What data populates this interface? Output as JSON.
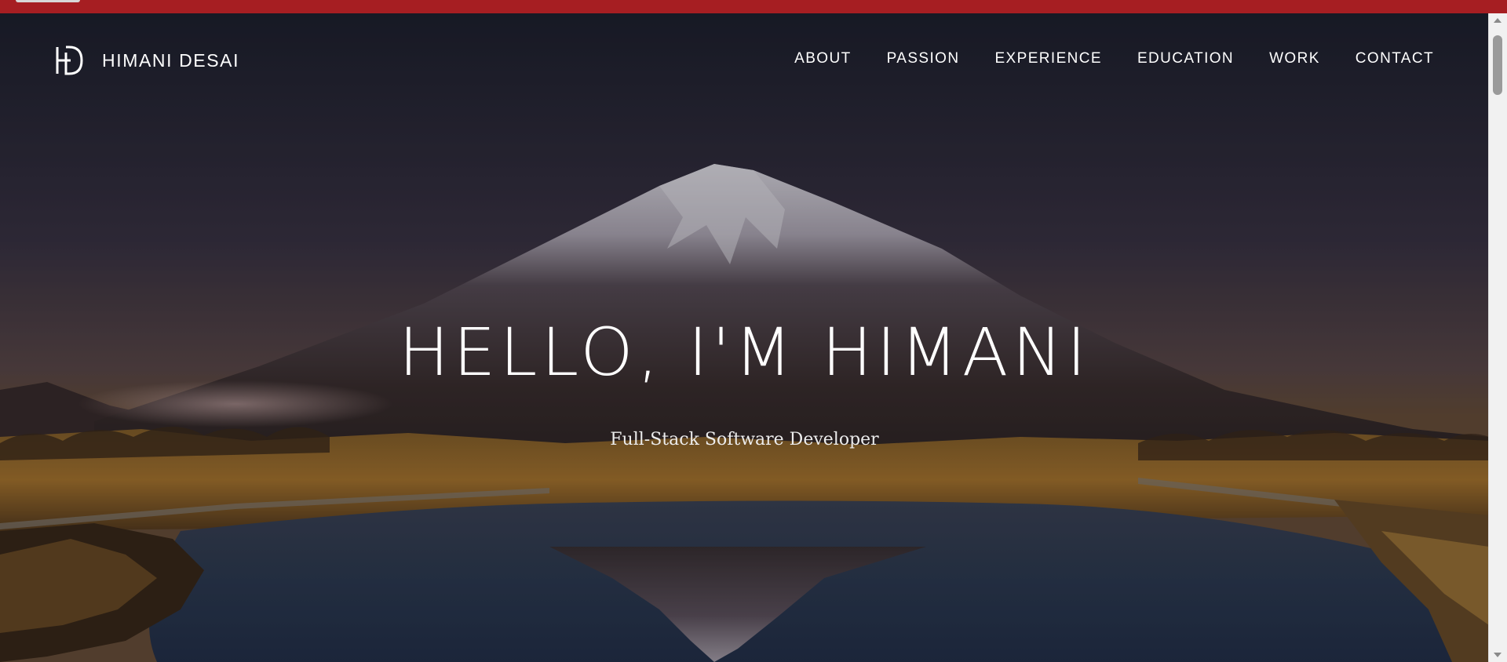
{
  "brand": {
    "logo_icon": "hd-monogram-icon",
    "name": "HIMANI DESAI"
  },
  "nav": {
    "items": [
      {
        "label": "ABOUT"
      },
      {
        "label": "PASSION"
      },
      {
        "label": "EXPERIENCE"
      },
      {
        "label": "EDUCATION"
      },
      {
        "label": "WORK"
      },
      {
        "label": "CONTACT"
      }
    ]
  },
  "hero": {
    "title": "HELLO, I'M HIMANI",
    "subtitle": "Full-Stack Software Developer",
    "background_image": "mountain-lake-reflection"
  },
  "colors": {
    "top_strip": "#a61e22",
    "text": "#ffffff"
  }
}
